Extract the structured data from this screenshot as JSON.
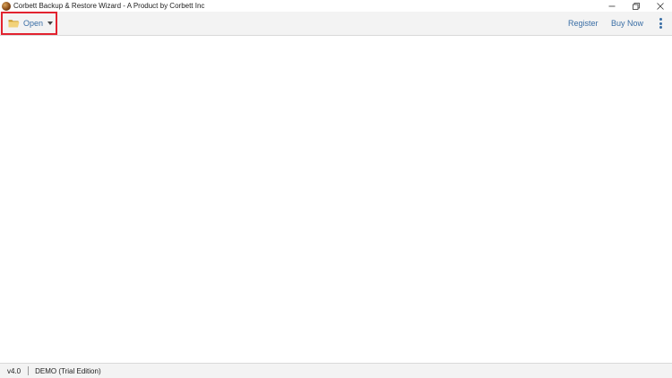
{
  "window": {
    "title": "Corbett Backup & Restore Wizard - A Product by Corbett Inc",
    "controls": [
      "minimize-icon",
      "restore-icon",
      "close-icon"
    ]
  },
  "toolbar": {
    "open_label": "Open",
    "register_label": "Register",
    "buynow_label": "Buy Now",
    "accent_color": "#3a6ea5",
    "highlight_color": "#e2232f"
  },
  "statusbar": {
    "version": "v4.0",
    "edition": "DEMO (Trial Edition)"
  }
}
